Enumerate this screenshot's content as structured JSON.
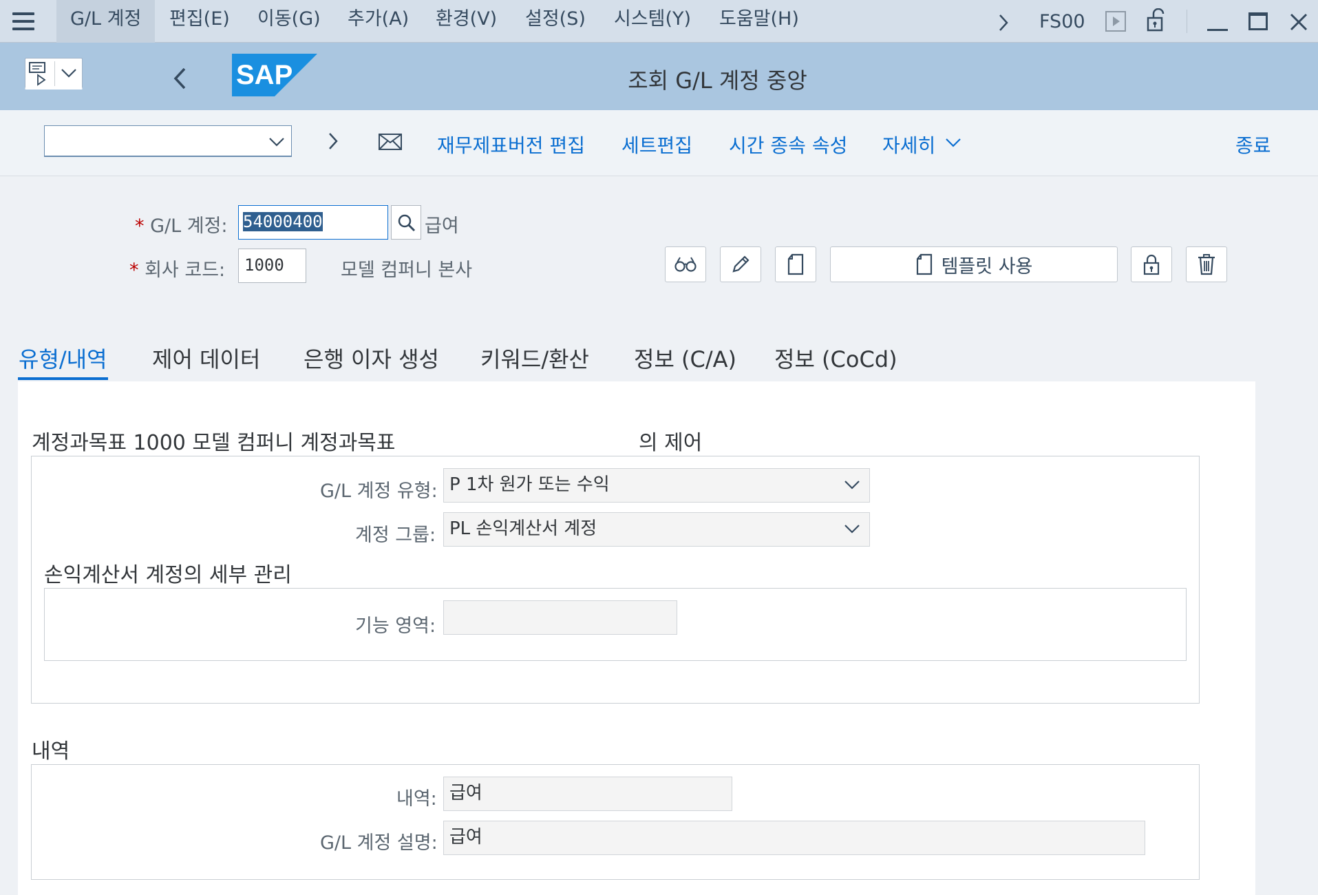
{
  "menubar": {
    "items": [
      "G/L 계정",
      "편집(E)",
      "이동(G)",
      "추가(A)",
      "환경(V)",
      "설정(S)",
      "시스템(Y)",
      "도움말(H)"
    ],
    "transaction_code": "FS00"
  },
  "titlebar": {
    "title": "조회 G/L 계정 중앙"
  },
  "toolbar": {
    "dropdown_value": "",
    "buttons": [
      "재무제표버전 편집",
      "세트편집",
      "시간 종속 속성",
      "자세히",
      "종료"
    ]
  },
  "header": {
    "gl_account_label": "G/L 계정:",
    "gl_account_value": "54000400",
    "gl_account_text": "급여",
    "company_code_label": "회사 코드:",
    "company_code_value": "1000",
    "company_code_text": "모델 컴퍼니 본사",
    "template_button": "템플릿 사용"
  },
  "tabs": [
    "유형/내역",
    "제어 데이터",
    "은행 이자 생성",
    "키워드/환산",
    "정보 (C/A)",
    "정보 (CoCd)"
  ],
  "active_tab": "유형/내역",
  "control_section": {
    "title": "계정과목표 1000 모델 컴퍼니 계정과목표",
    "title_suffix": "의 제어",
    "account_type_label": "G/L 계정 유형:",
    "account_type_value": "P 1차 원가 또는 수익",
    "account_group_label": "계정 그룹:",
    "account_group_value": "PL 손익계산서 계정",
    "pl_title": "손익계산서 계정의 세부 관리",
    "functional_area_label": "기능 영역:",
    "functional_area_value": ""
  },
  "description_section": {
    "title": "내역",
    "short_text_label": "내역:",
    "short_text_value": "급여",
    "long_text_label": "G/L 계정 설명:",
    "long_text_value": "급여"
  },
  "colors": {
    "accent": "#0a6ed1",
    "titlebar_bg": "#aac6e0",
    "menubar_bg": "#d5dfea",
    "required": "#bb0000",
    "sap_logo": "#1a8fe0"
  }
}
